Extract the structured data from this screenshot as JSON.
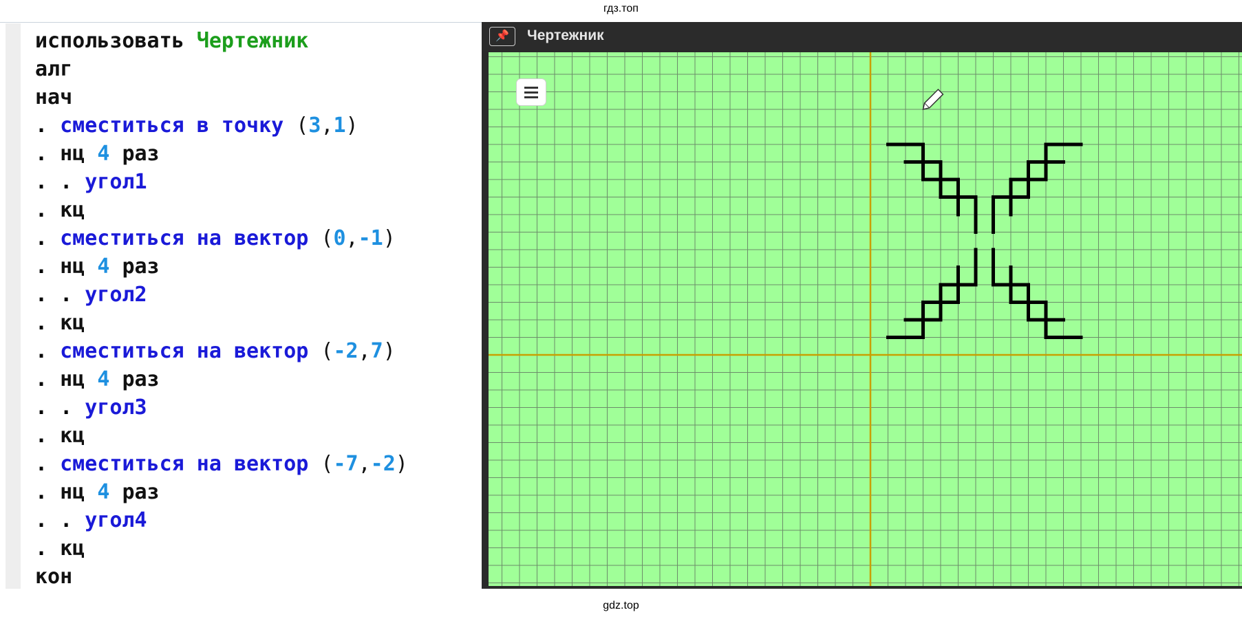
{
  "watermark_top": "гдз.топ",
  "watermark_bottom": "gdz.top",
  "editor": {
    "lines": [
      [
        {
          "t": "использовать",
          "c": "kw"
        },
        {
          "t": " ",
          "c": "kw"
        },
        {
          "t": "Чертежник",
          "c": "kw-green"
        }
      ],
      [
        {
          "t": "алг",
          "c": "kw"
        }
      ],
      [
        {
          "t": "нач",
          "c": "kw"
        }
      ],
      [
        {
          "t": "."
        },
        {
          "t": " "
        },
        {
          "t": "сместиться в точку",
          "c": "cmd"
        },
        {
          "t": " (",
          "c": "punc"
        },
        {
          "t": "3",
          "c": "num"
        },
        {
          "t": ",",
          "c": "punc"
        },
        {
          "t": "1",
          "c": "num"
        },
        {
          "t": ")",
          "c": "punc"
        }
      ],
      [
        {
          "t": "."
        },
        {
          "t": " "
        },
        {
          "t": "нц",
          "c": "kw"
        },
        {
          "t": " "
        },
        {
          "t": "4",
          "c": "num"
        },
        {
          "t": " "
        },
        {
          "t": "раз",
          "c": "kw"
        }
      ],
      [
        {
          "t": "."
        },
        {
          "t": " "
        },
        {
          "t": "."
        },
        {
          "t": " "
        },
        {
          "t": "угол1",
          "c": "cmd"
        }
      ],
      [
        {
          "t": "."
        },
        {
          "t": " "
        },
        {
          "t": "кц",
          "c": "kw"
        }
      ],
      [
        {
          "t": "."
        },
        {
          "t": " "
        },
        {
          "t": "сместиться на вектор",
          "c": "cmd"
        },
        {
          "t": " (",
          "c": "punc"
        },
        {
          "t": "0",
          "c": "num"
        },
        {
          "t": ",",
          "c": "punc"
        },
        {
          "t": "-1",
          "c": "num"
        },
        {
          "t": ")",
          "c": "punc"
        }
      ],
      [
        {
          "t": "."
        },
        {
          "t": " "
        },
        {
          "t": "нц",
          "c": "kw"
        },
        {
          "t": " "
        },
        {
          "t": "4",
          "c": "num"
        },
        {
          "t": " "
        },
        {
          "t": "раз",
          "c": "kw"
        }
      ],
      [
        {
          "t": "."
        },
        {
          "t": " "
        },
        {
          "t": "."
        },
        {
          "t": " "
        },
        {
          "t": "угол2",
          "c": "cmd"
        }
      ],
      [
        {
          "t": "."
        },
        {
          "t": " "
        },
        {
          "t": "кц",
          "c": "kw"
        }
      ],
      [
        {
          "t": "."
        },
        {
          "t": " "
        },
        {
          "t": "сместиться на вектор",
          "c": "cmd"
        },
        {
          "t": " (",
          "c": "punc"
        },
        {
          "t": "-2",
          "c": "num"
        },
        {
          "t": ",",
          "c": "punc"
        },
        {
          "t": "7",
          "c": "num"
        },
        {
          "t": ")",
          "c": "punc"
        }
      ],
      [
        {
          "t": "."
        },
        {
          "t": " "
        },
        {
          "t": "нц",
          "c": "kw"
        },
        {
          "t": " "
        },
        {
          "t": "4",
          "c": "num"
        },
        {
          "t": " "
        },
        {
          "t": "раз",
          "c": "kw"
        }
      ],
      [
        {
          "t": "."
        },
        {
          "t": " "
        },
        {
          "t": "."
        },
        {
          "t": " "
        },
        {
          "t": "угол3",
          "c": "cmd"
        }
      ],
      [
        {
          "t": "."
        },
        {
          "t": " "
        },
        {
          "t": "кц",
          "c": "kw"
        }
      ],
      [
        {
          "t": "."
        },
        {
          "t": " "
        },
        {
          "t": "сместиться на вектор",
          "c": "cmd"
        },
        {
          "t": " (",
          "c": "punc"
        },
        {
          "t": "-7",
          "c": "num"
        },
        {
          "t": ",",
          "c": "punc"
        },
        {
          "t": "-2",
          "c": "num"
        },
        {
          "t": ")",
          "c": "punc"
        }
      ],
      [
        {
          "t": "."
        },
        {
          "t": " "
        },
        {
          "t": "нц",
          "c": "kw"
        },
        {
          "t": " "
        },
        {
          "t": "4",
          "c": "num"
        },
        {
          "t": " "
        },
        {
          "t": "раз",
          "c": "kw"
        }
      ],
      [
        {
          "t": "."
        },
        {
          "t": " "
        },
        {
          "t": "."
        },
        {
          "t": " "
        },
        {
          "t": "угол4",
          "c": "cmd"
        }
      ],
      [
        {
          "t": "."
        },
        {
          "t": " "
        },
        {
          "t": "кц",
          "c": "kw"
        }
      ],
      [
        {
          "t": "кон",
          "c": "kw"
        }
      ]
    ]
  },
  "drawer": {
    "title": "Чертежник",
    "pin_icon": "pin-icon",
    "menu_icon": "hamburger-menu-icon",
    "pen_icon": "pencil-icon",
    "colors": {
      "background": "#a0ff98",
      "grid": "#6c8c6a",
      "axis": "#c8a000",
      "stroke": "#000000"
    },
    "pen_position": [
      3,
      14
    ],
    "segments": [
      [
        3,
        10,
        3,
        12
      ],
      [
        3,
        12,
        1,
        12
      ],
      [
        4,
        9,
        4,
        11
      ],
      [
        4,
        11,
        2,
        11
      ],
      [
        5,
        8,
        5,
        10
      ],
      [
        5,
        10,
        3,
        10
      ],
      [
        6,
        7,
        6,
        9
      ],
      [
        6,
        9,
        4,
        9
      ],
      [
        10,
        10,
        10,
        12
      ],
      [
        10,
        12,
        12,
        12
      ],
      [
        9,
        9,
        9,
        11
      ],
      [
        9,
        11,
        11,
        11
      ],
      [
        8,
        8,
        8,
        10
      ],
      [
        8,
        10,
        10,
        10
      ],
      [
        7,
        7,
        7,
        9
      ],
      [
        7,
        9,
        9,
        9
      ],
      [
        3,
        3,
        3,
        1
      ],
      [
        3,
        1,
        1,
        1
      ],
      [
        4,
        4,
        4,
        2
      ],
      [
        4,
        2,
        2,
        2
      ],
      [
        5,
        5,
        5,
        3
      ],
      [
        5,
        3,
        3,
        3
      ],
      [
        6,
        6,
        6,
        4
      ],
      [
        6,
        4,
        4,
        4
      ],
      [
        10,
        3,
        10,
        1
      ],
      [
        10,
        1,
        12,
        1
      ],
      [
        9,
        4,
        9,
        2
      ],
      [
        9,
        2,
        11,
        2
      ],
      [
        8,
        5,
        8,
        3
      ],
      [
        8,
        3,
        10,
        3
      ],
      [
        7,
        6,
        7,
        4
      ],
      [
        7,
        4,
        9,
        4
      ]
    ]
  }
}
